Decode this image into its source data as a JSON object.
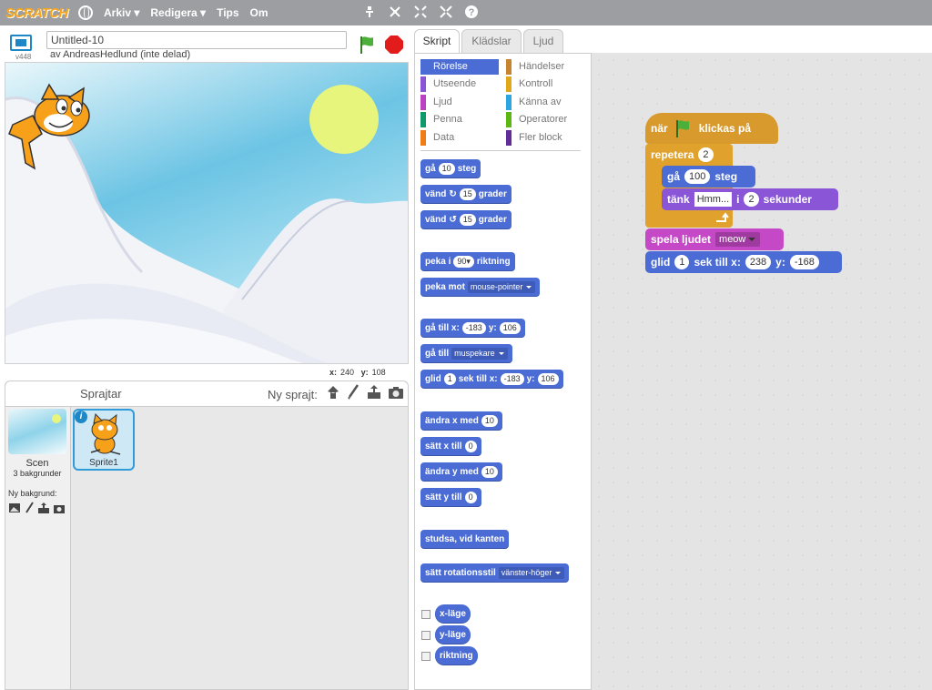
{
  "menubar": {
    "logo": "SCRATCH",
    "menus": [
      "Arkiv ▾",
      "Redigera ▾",
      "Tips",
      "Om"
    ],
    "tool_icons": [
      "duplicate-icon",
      "cut-icon",
      "grow-icon",
      "shrink-icon",
      "help-icon"
    ]
  },
  "stage": {
    "version": "v448",
    "project_title": "Untitled-10",
    "author": "av AndreasHedlund (inte delad)",
    "coords": {
      "x_label": "x:",
      "x": "240",
      "y_label": "y:",
      "y": "108"
    }
  },
  "sprites_pane": {
    "header": "Sprajtar",
    "new_sprite": "Ny sprajt:",
    "scene_label": "Scen",
    "scene_count": "3 bakgrunder",
    "new_backdrop": "Ny bakgrund:",
    "sprite_name": "Sprite1"
  },
  "tabs": [
    "Skript",
    "Klädslar",
    "Ljud"
  ],
  "categories": {
    "left": [
      {
        "label": "Rörelse",
        "color": "#4a6cd4"
      },
      {
        "label": "Utseende",
        "color": "#8a55d7"
      },
      {
        "label": "Ljud",
        "color": "#bb42c3"
      },
      {
        "label": "Penna",
        "color": "#0e9a6c"
      },
      {
        "label": "Data",
        "color": "#ee7d16"
      }
    ],
    "right": [
      {
        "label": "Händelser",
        "color": "#c88330"
      },
      {
        "label": "Kontroll",
        "color": "#e1a91a"
      },
      {
        "label": "Känna av",
        "color": "#2ca5e2"
      },
      {
        "label": "Operatorer",
        "color": "#5cb712"
      },
      {
        "label": "Fler block",
        "color": "#632d99"
      }
    ]
  },
  "palette": {
    "move": {
      "a": "gå",
      "v": "10",
      "b": "steg"
    },
    "turn_right": {
      "a": "vänd",
      "v": "15",
      "b": "grader"
    },
    "turn_left": {
      "a": "vänd",
      "v": "15",
      "b": "grader"
    },
    "point_dir": {
      "a": "peka i",
      "v": "90▾",
      "b": "riktning"
    },
    "point_towards": {
      "a": "peka mot",
      "v": "mouse-pointer"
    },
    "goto_xy": {
      "a": "gå till x:",
      "x": "-183",
      "b": "y:",
      "y": "106"
    },
    "goto": {
      "a": "gå till",
      "v": "muspekare"
    },
    "glide": {
      "a": "glid",
      "v": "1",
      "b": "sek till x:",
      "x": "-183",
      "c": "y:",
      "y": "106"
    },
    "change_x": {
      "a": "ändra x med",
      "v": "10"
    },
    "set_x": {
      "a": "sätt x till",
      "v": "0"
    },
    "change_y": {
      "a": "ändra y med",
      "v": "10"
    },
    "set_y": {
      "a": "sätt y till",
      "v": "0"
    },
    "bounce": {
      "a": "studsa, vid kanten"
    },
    "rotation": {
      "a": "sätt rotationsstil",
      "v": "vänster-höger"
    },
    "reporters": [
      "x-läge",
      "y-läge",
      "riktning"
    ]
  },
  "script": {
    "hat": {
      "a": "när",
      "b": "klickas på"
    },
    "repeat": {
      "a": "repetera",
      "v": "2"
    },
    "move": {
      "a": "gå",
      "v": "100",
      "b": "steg"
    },
    "think": {
      "a": "tänk",
      "v": "Hmm...",
      "b": "i",
      "n": "2",
      "c": "sekunder"
    },
    "sound": {
      "a": "spela ljudet",
      "v": "meow"
    },
    "glide": {
      "a": "glid",
      "v": "1",
      "b": "sek till x:",
      "x": "238",
      "c": "y:",
      "y": "-168"
    }
  }
}
